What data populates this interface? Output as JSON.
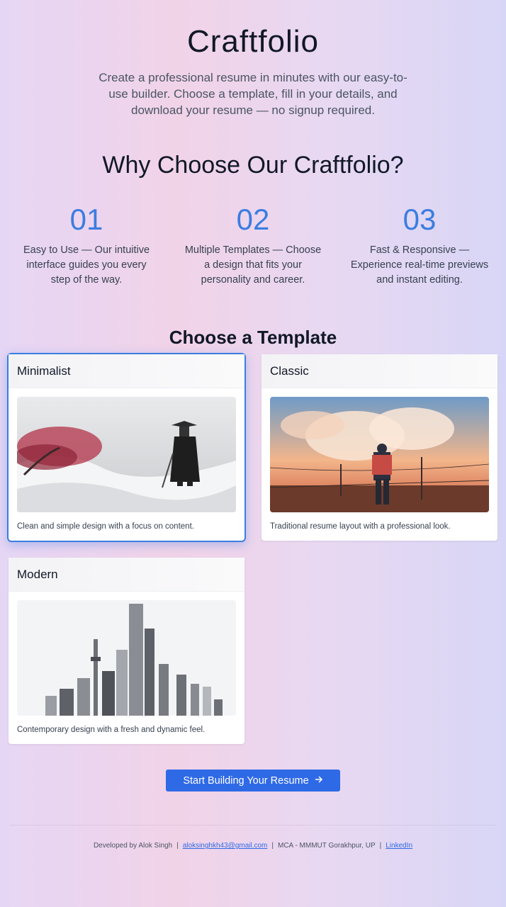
{
  "hero": {
    "title": "Craftfolio",
    "subtitle": "Create a professional resume in minutes with our easy-to-use builder. Choose a template, fill in your details, and download your resume — no signup required."
  },
  "why": {
    "title": "Why Choose Our Craftfolio?",
    "features": [
      {
        "num": "01",
        "text": "Easy to Use — Our intuitive interface guides you every step of the way."
      },
      {
        "num": "02",
        "text": "Multiple Templates — Choose a design that fits your personality and career."
      },
      {
        "num": "03",
        "text": "Fast & Responsive — Experience real-time previews and instant editing."
      }
    ]
  },
  "templates": {
    "title": "Choose a Template",
    "items": [
      {
        "name": "Minimalist",
        "desc": "Clean and simple design with a focus on content.",
        "selected": true
      },
      {
        "name": "Classic",
        "desc": "Traditional resume layout with a professional look.",
        "selected": false
      },
      {
        "name": "Modern",
        "desc": "Contemporary design with a fresh and dynamic feel.",
        "selected": false
      }
    ]
  },
  "cta": {
    "label": "Start Building Your Resume",
    "icon": "arrow-right-icon"
  },
  "footer": {
    "developer": "Developed by Alok Singh",
    "email": "aloksinghkh43@gmail.com",
    "affiliation": "MCA - MMMUT Gorakhpur, UP",
    "linkedin": "LinkedIn",
    "separator": "|"
  },
  "colors": {
    "accent": "#3b7de0",
    "button": "#2f6ae6"
  }
}
